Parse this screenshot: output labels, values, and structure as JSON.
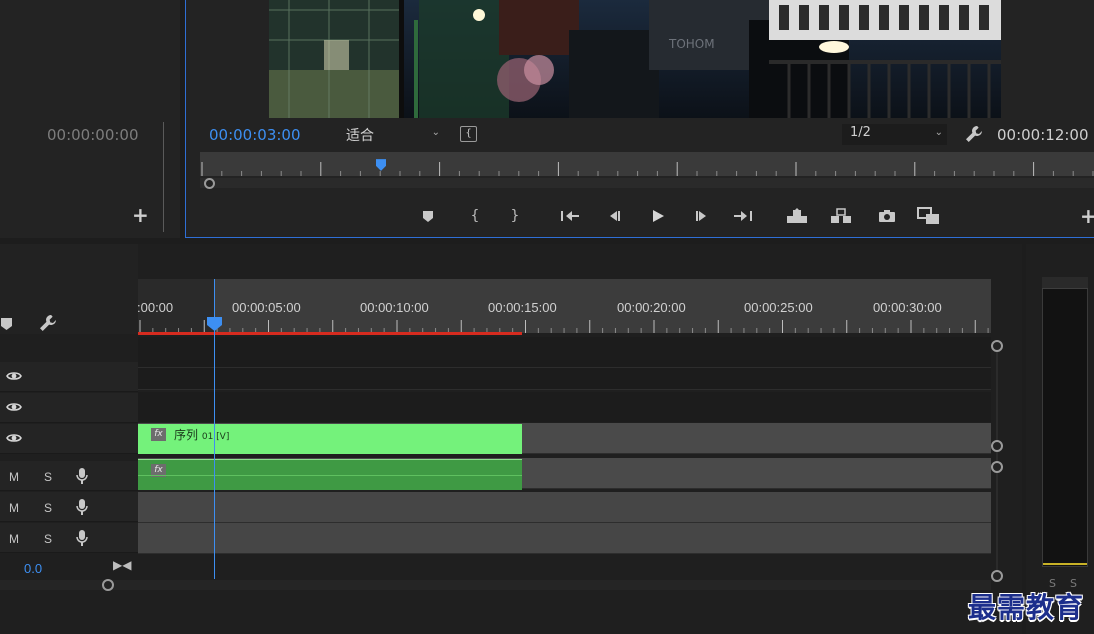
{
  "source_monitor": {
    "timecode": "00:00:00:00",
    "add_label": "+"
  },
  "program_monitor": {
    "timecode": "00:00:03:00",
    "fit_value": "适合",
    "resolution_value": "1/2",
    "duration": "00:00:12:00",
    "add_label": "+",
    "playhead_fraction": 0.25
  },
  "transport": {
    "buttons": [
      "add-marker",
      "mark-in",
      "mark-out",
      "go-to-in",
      "step-back",
      "play",
      "step-forward",
      "go-to-out",
      "lift",
      "extract",
      "export-frame",
      "comparison-view"
    ]
  },
  "timeline": {
    "ruler_labels": [
      ":00:00",
      "00:00:05:00",
      "00:00:10:00",
      "00:00:15:00",
      "00:00:20:00",
      "00:00:25:00",
      "00:00:30:00"
    ],
    "tracks": [
      {
        "id": "V3",
        "type": "video"
      },
      {
        "id": "V2",
        "type": "video"
      },
      {
        "id": "V1",
        "type": "video"
      },
      {
        "id": "A1",
        "type": "audio",
        "m": "M",
        "s": "S"
      },
      {
        "id": "A2",
        "type": "audio",
        "m": "M",
        "s": "S"
      },
      {
        "id": "A3",
        "type": "audio",
        "m": "M",
        "s": "S"
      }
    ],
    "video_clip": {
      "fx": "fx",
      "name": "序列",
      "suffix": "01 [V]"
    },
    "audio_clip": {
      "fx": "fx"
    },
    "mix_value": "0.0"
  },
  "meters": {
    "s_left": "S",
    "s_right": "S"
  },
  "watermark": "最需教育",
  "colors": {
    "accent": "#3d8ff2",
    "clip_video": "#74f27b",
    "clip_audio": "#3f9a44",
    "work_area": "#d62b1f",
    "meter_peak": "#c9b227"
  }
}
